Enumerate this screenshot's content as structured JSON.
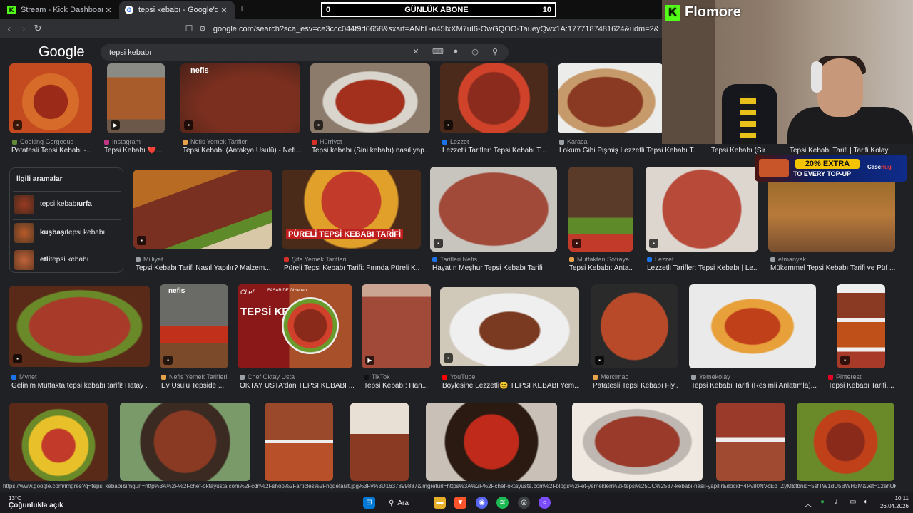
{
  "tabs": [
    {
      "label": "Stream - Kick Dashboard",
      "icon": "kick-icon"
    },
    {
      "label": "tepsi kebabı - Google'da Ara",
      "icon": "google-icon"
    }
  ],
  "sub_counter": {
    "left": "0",
    "label": "GÜNLÜK ABONE",
    "right": "10"
  },
  "address": {
    "url": "google.com/search?sca_esv=ce3ccc044f9d6658&sxsrf=ANbL-n45IxXM7uI6-OwGQOO-TaueyQwx1A:1777187481624&udm=2&fbs=ADc_l-bVGNtJltv..."
  },
  "google": {
    "logo": "Google",
    "query": "tepsi kebabı"
  },
  "related": {
    "heading": "İlgili aramalar",
    "items": [
      {
        "bold": "",
        "text": "tepsi kebabı ",
        "bold2": "urfa"
      },
      {
        "bold": "kuşbaşı",
        "text": " tepsi kebabı",
        "bold2": ""
      },
      {
        "bold": "etli",
        "text": " tepsi kebabı",
        "bold2": ""
      }
    ]
  },
  "results": [
    {
      "source": "Cooking Gorgeous",
      "caption": "Patatesli Tepsi Kebabı -...",
      "color": "#5f8a3a"
    },
    {
      "source": "Instagram",
      "caption": "Tepsi Kebabı ❤️...",
      "color": "#c13584"
    },
    {
      "source": "Nefis Yemek Tarifleri",
      "caption": "Tepsi Kebabı (Antakya Usulü) - Nefi...",
      "color": "#e8a34a"
    },
    {
      "source": "Hürriyet",
      "caption": "Tepsi kebabı (Sini kebabı) nasıl yap...",
      "color": "#d93025"
    },
    {
      "source": "Lezzet",
      "caption": "Lezzetli Tarifler: Tepsi Kebabı T...",
      "color": "#1a73e8"
    },
    {
      "source": "Karaca",
      "caption": "Lokum Gibi Pişmiş Lezzetli Tepsi Kebabı T...",
      "color": "#9aa0a6"
    },
    {
      "source": "",
      "caption": "Tepsi Kebabı (Sini",
      "color": "#9aa0a6"
    },
    {
      "source": "",
      "caption": "Tepsi Kebabı Tarifi | Tarifi Kolay",
      "color": "#9aa0a6"
    },
    {
      "source": "Milliyet",
      "caption": "Tepsi Kebabı Tarifi Nasıl Yapılır? Malzem...",
      "color": "#9aa0a6"
    },
    {
      "source": "Şifa Yemek Tarifleri",
      "caption": "Püreli Tepsi Kebabı Tarifi: Fırında Püreli K...",
      "color": "#d93025"
    },
    {
      "source": "Tarifleri Nefis",
      "caption": "Hayatın Meşhur Tepsi Kebabı Tarifi",
      "color": "#1a73e8"
    },
    {
      "source": "Mutfaktan Sofraya",
      "caption": "Tepsi Kebabı: Anta...",
      "color": "#e8a34a"
    },
    {
      "source": "Lezzet",
      "caption": "Lezzetli Tarifler: Tepsi Kebabı | Le...",
      "color": "#1a73e8"
    },
    {
      "source": "etmanyak",
      "caption": "Mükemmel Tepsi Kebabı Tarifi ve Püf ...",
      "color": "#9aa0a6"
    },
    {
      "source": "Mynet",
      "caption": "Gelinim Mutfakta tepsi kebabı tarifi! Hatay ...",
      "color": "#1a73e8"
    },
    {
      "source": "Nefis Yemek Tarifleri",
      "caption": "Ev Usulü Tepside ...",
      "color": "#e8a34a"
    },
    {
      "source": "Chef Oktay Usta",
      "caption": "OKTAY USTA'dan TEPSİ KEBABI ...",
      "color": "#9aa0a6"
    },
    {
      "source": "TikTok",
      "caption": "Tepsi Kebabı: Han...",
      "color": "#111111"
    },
    {
      "source": "YouTube",
      "caption": "Böylesine Lezzetli😊 TEPSİ KEBABI Yem...",
      "color": "#ff0000"
    },
    {
      "source": "Mercimac",
      "caption": "Patatesli Tepsi Kebabı Fiy...",
      "color": "#e8a34a"
    },
    {
      "source": "Yemekolay",
      "caption": "Tepsi Kebabı Tarifi (Resimli Anlatımla)...",
      "color": "#9aa0a6"
    },
    {
      "source": "Pinterest",
      "caption": "Tepsi Kebabı Tarifi,...",
      "color": "#e60023"
    }
  ],
  "image_overlays": {
    "nefis": "nefis",
    "pureli": "PÜRELİ TEPSİ KEBABI TARİFİ",
    "oktay_title": "TEPSİ KEBABI",
    "oktay_sub": "FASARIDE Gizlenen",
    "chef": "Chef"
  },
  "stream": {
    "brand": "Flomore",
    "promo_main": "20% EXTRA",
    "promo_sub": "TO EVERY TOP-UP",
    "promo_logo_a": "Case",
    "promo_logo_b": "hug"
  },
  "status_url": "https://www.google.com/imgres?q=tepsi kebabı&imgurl=http%3A%2F%2Fchef-oktayusta.com%2Fcdn%2Fshop%2Farticles%2Fhqdefault.jpg%3Fv%3D1637899887&imgrefurl=https%3A%2F%2Fchef-oktayusta.com%2Fblogs%2Fet-yemekleri%2Ftepsi%25CC%2587-kebabi-nasil-yapilir&docid=4Pv80NVcEb_ZyM&tbnid=5sfTW1dU5BWH3M&vet=12ahUKE...",
  "taskbar": {
    "temp": "13°C",
    "weather": "Çoğunlukla açık",
    "search": "Ara",
    "time": "10:11",
    "date": "26.04.2026"
  },
  "colors": {
    "bg": "#202124",
    "kick_green": "#53fc18",
    "accent_yellow": "#f5c400"
  }
}
